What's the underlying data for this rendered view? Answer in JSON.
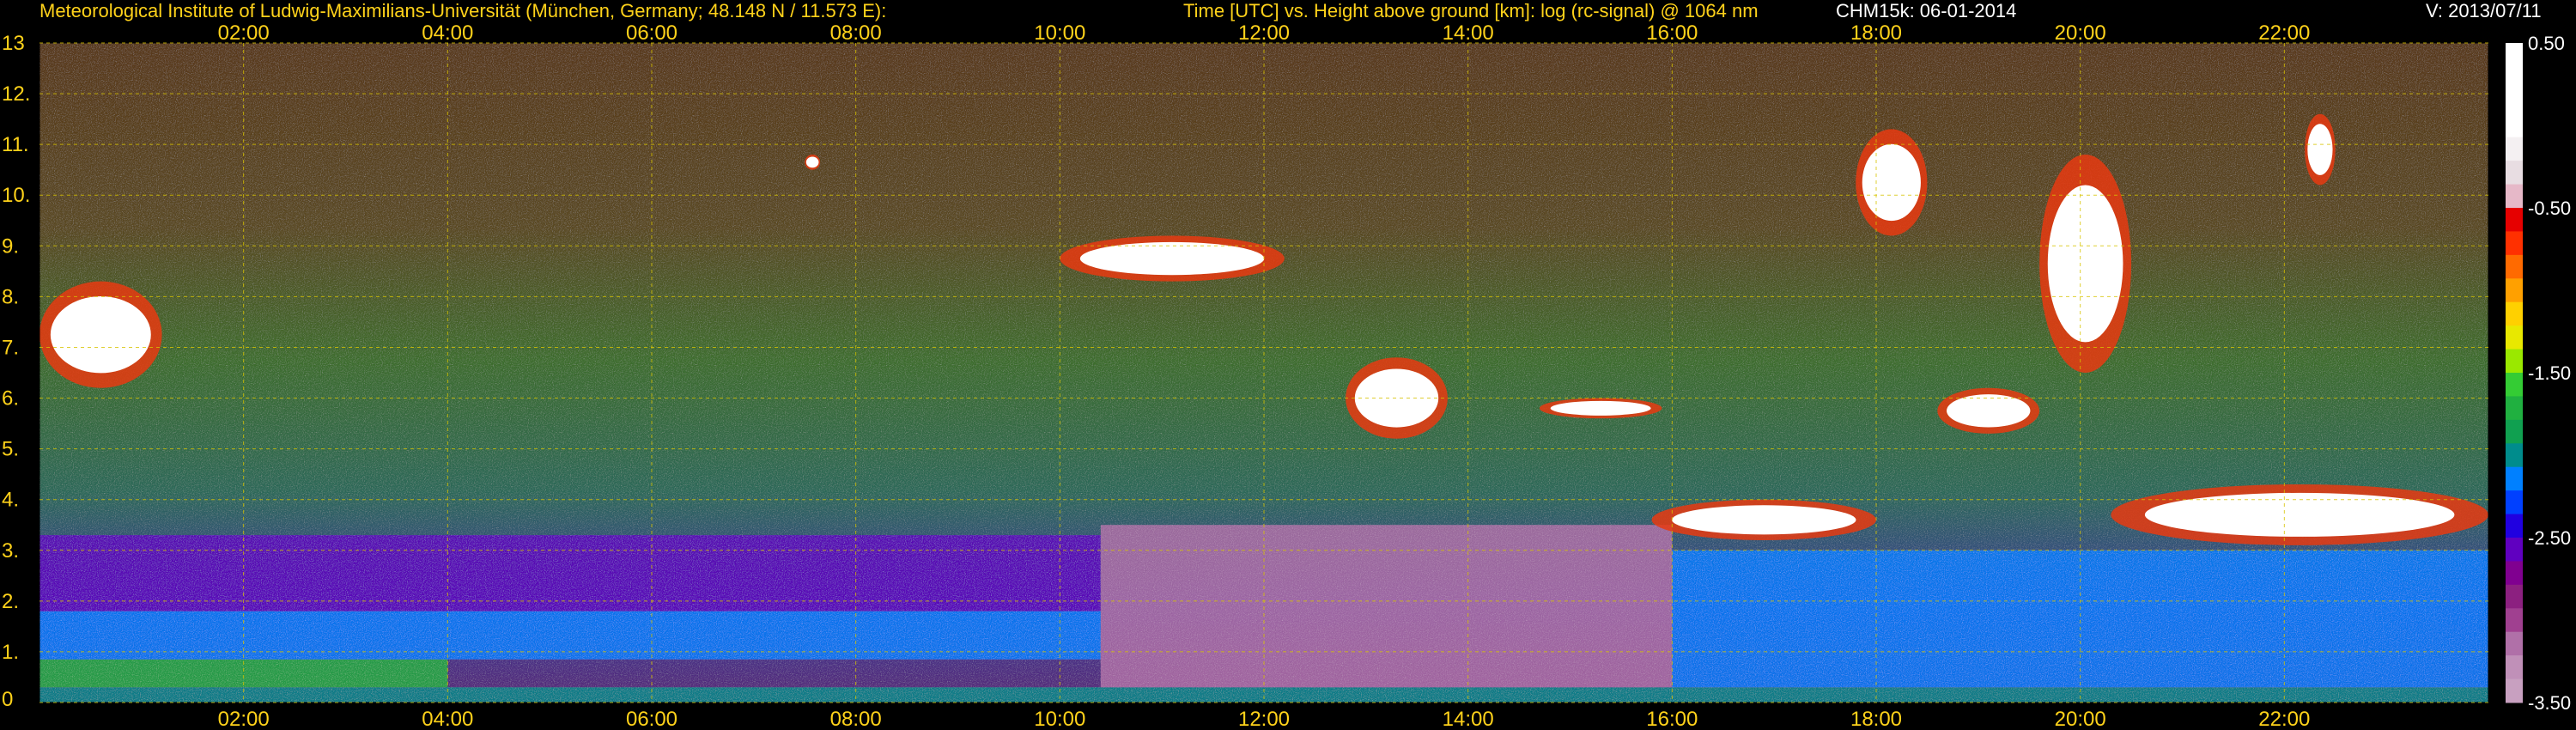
{
  "header": {
    "institute": "Meteorological Institute of Ludwig-Maximilians-Universität (München, Germany; 48.148 N / 11.573 E):",
    "axes_desc": "Time [UTC] vs. Height above ground [km]: log (rc-signal) @ 1064 nm",
    "instrument": "CHM15k: 06-01-2014",
    "version": "V: 2013/07/11"
  },
  "colors": {
    "header_text": "#ffd21a",
    "instrument_text": "#ffffff",
    "grid": "#d8c400",
    "background": "#000000"
  },
  "chart_data": {
    "type": "heatmap",
    "title": "Time [UTC] vs. Height above ground [km]: log (rc-signal) @ 1064 nm",
    "xlabel": "",
    "ylabel": "",
    "x_range_hours": [
      0,
      24
    ],
    "y_range_km": [
      0,
      13
    ],
    "x_ticks": [
      "02:00",
      "04:00",
      "06:00",
      "08:00",
      "10:00",
      "12:00",
      "14:00",
      "16:00",
      "18:00",
      "20:00",
      "22:00"
    ],
    "x_tick_hours": [
      2,
      4,
      6,
      8,
      10,
      12,
      14,
      16,
      18,
      20,
      22
    ],
    "y_ticks": [
      "0",
      "1.",
      "2.",
      "3.",
      "4.",
      "5.",
      "6.",
      "7.",
      "8.",
      "9.",
      "10.",
      "11.",
      "12.",
      "13"
    ],
    "y_tick_values": [
      0,
      1,
      2,
      3,
      4,
      5,
      6,
      7,
      8,
      9,
      10,
      11,
      12,
      13
    ],
    "grid": true,
    "colorbar": {
      "range": [
        -3.5,
        0.5
      ],
      "labels": [
        "0.50",
        "-0.50",
        "-1.50",
        "-2.50",
        "-3.50"
      ],
      "label_values": [
        0.5,
        -0.5,
        -1.5,
        -2.5,
        -3.5
      ],
      "colors": [
        "#ffffff",
        "#ffffff",
        "#ffffff",
        "#ffffff",
        "#f4f0f2",
        "#e8dde2",
        "#e6b8c8",
        "#e60000",
        "#ff3000",
        "#ff6a00",
        "#ffa000",
        "#ffd000",
        "#e8e800",
        "#9ae800",
        "#34cc34",
        "#20b040",
        "#10a050",
        "#008c8c",
        "#0080ff",
        "#0040ff",
        "#2000e0",
        "#6000c0",
        "#800090",
        "#8c2080",
        "#a04090",
        "#b070a8",
        "#c090b8",
        "#c8a0c0"
      ]
    },
    "layers": [
      {
        "name": "surface",
        "t0": 0.0,
        "t1": 24.0,
        "h0": 0.0,
        "h1": 0.3,
        "v": -2.0
      },
      {
        "name": "boundary-layer-green",
        "t0": 0.0,
        "t1": 4.0,
        "h0": 0.3,
        "h1": 0.85,
        "v": -1.65
      },
      {
        "name": "boundary-layer-blue-night",
        "t0": 0.0,
        "t1": 10.4,
        "h0": 0.85,
        "h1": 1.8,
        "v": -2.15
      },
      {
        "name": "purple-low",
        "t0": 0.0,
        "t1": 10.4,
        "h0": 1.8,
        "h1": 3.3,
        "v": -2.55
      },
      {
        "name": "daytime-mixed-layer",
        "t0": 10.4,
        "t1": 16.0,
        "h0": 0.3,
        "h1": 3.5,
        "v": -3.2
      },
      {
        "name": "evening-blue",
        "t0": 16.0,
        "t1": 24.0,
        "h0": 0.3,
        "h1": 3.0,
        "v": -2.2
      }
    ],
    "clouds": [
      {
        "t0": 0.0,
        "t1": 1.2,
        "h0": 6.2,
        "h1": 8.3,
        "v": 0.5
      },
      {
        "t0": 7.5,
        "t1": 7.65,
        "h0": 10.5,
        "h1": 10.8,
        "v": 0.5
      },
      {
        "t0": 10.0,
        "t1": 12.2,
        "h0": 8.3,
        "h1": 9.2,
        "v": 0.5
      },
      {
        "t0": 12.8,
        "t1": 13.8,
        "h0": 5.2,
        "h1": 6.8,
        "v": 0.2
      },
      {
        "t0": 14.7,
        "t1": 15.9,
        "h0": 5.6,
        "h1": 6.0,
        "v": 0.5
      },
      {
        "t0": 15.8,
        "t1": 18.0,
        "h0": 3.2,
        "h1": 4.0,
        "v": 0.4
      },
      {
        "t0": 17.8,
        "t1": 18.5,
        "h0": 9.2,
        "h1": 11.3,
        "v": 0.5
      },
      {
        "t0": 18.6,
        "t1": 19.6,
        "h0": 5.3,
        "h1": 6.2,
        "v": 0.2
      },
      {
        "t0": 19.6,
        "t1": 20.5,
        "h0": 6.5,
        "h1": 10.8,
        "v": 0.5
      },
      {
        "t0": 20.3,
        "t1": 24.0,
        "h0": 3.1,
        "h1": 4.3,
        "v": 0.5
      },
      {
        "t0": 22.2,
        "t1": 22.5,
        "h0": 10.2,
        "h1": 11.6,
        "v": 0.5
      }
    ]
  }
}
